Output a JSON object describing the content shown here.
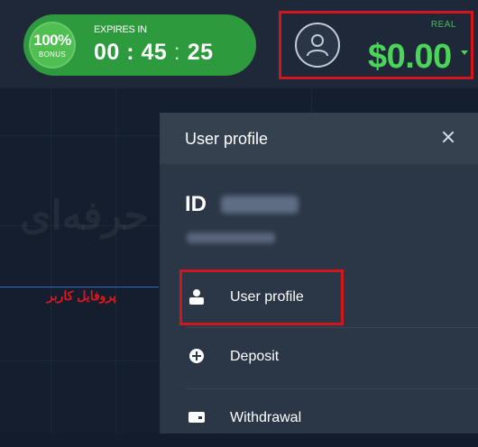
{
  "bonus": {
    "percent": "100%",
    "label": "BONUS"
  },
  "timer": {
    "label": "EXPIRES IN",
    "hours": "00",
    "minutes": "45",
    "seconds": "25"
  },
  "account": {
    "type_label": "REAL",
    "balance": "$0.00"
  },
  "panel": {
    "title": "User profile",
    "id_prefix": "ID",
    "menu": [
      {
        "label": "User profile",
        "icon": "user-icon"
      },
      {
        "label": "Deposit",
        "icon": "plus-circle-icon"
      },
      {
        "label": "Withdrawal",
        "icon": "card-icon"
      }
    ]
  },
  "annotation": {
    "text": "پروفایل کاربر"
  },
  "watermark": {
    "text": "فارکس حرفه‌ای"
  },
  "colors": {
    "accent_green": "#4cd35a",
    "highlight_red": "#d2161c",
    "panel": "#2b3647"
  }
}
